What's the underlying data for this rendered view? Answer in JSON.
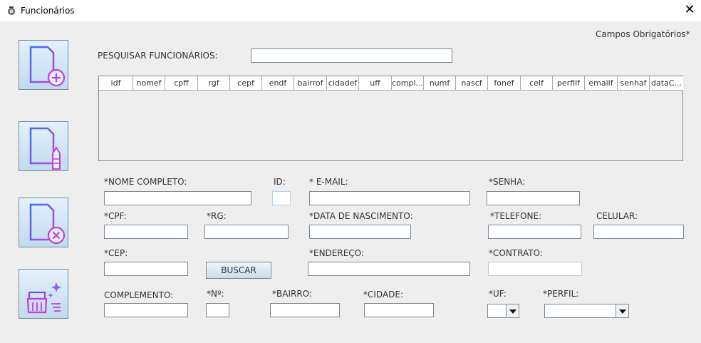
{
  "window": {
    "title": "Funcionários"
  },
  "required_note": "Campos Obrigatórios*",
  "search": {
    "label": "PESQUISAR FUNCIONÁRIOS:",
    "value": ""
  },
  "table": {
    "columns": [
      "idf",
      "nomef",
      "cpff",
      "rgf",
      "cepf",
      "endf",
      "bairrof",
      "cidadef",
      "uff",
      "compl...",
      "numf",
      "nascf",
      "fonef",
      "celf",
      "perfilf",
      "emailf",
      "senhaf",
      "dataC..."
    ],
    "rows": []
  },
  "sidebar": {
    "buttons": [
      {
        "icon": "document-add-icon"
      },
      {
        "icon": "document-edit-icon"
      },
      {
        "icon": "document-delete-icon"
      },
      {
        "icon": "broom-clean-icon"
      }
    ]
  },
  "form": {
    "nome": {
      "label": "*NOME COMPLETO:",
      "value": ""
    },
    "id": {
      "label": "ID:",
      "value": ""
    },
    "email": {
      "label": "* E-MAIL:",
      "value": ""
    },
    "senha": {
      "label": "*SENHA:",
      "value": ""
    },
    "cpf": {
      "label": "*CPF:",
      "value": ""
    },
    "rg": {
      "label": "*RG:",
      "value": ""
    },
    "nascimento": {
      "label": "*DATA DE NASCIMENTO:",
      "value": ""
    },
    "telefone": {
      "label": "*TELEFONE:",
      "value": ""
    },
    "celular": {
      "label": "CELULAR:",
      "value": ""
    },
    "cep": {
      "label": "*CEP:",
      "value": ""
    },
    "buscar_label": "BUSCAR",
    "endereco": {
      "label": "*ENDEREÇO:",
      "value": ""
    },
    "contrato": {
      "label": "*CONTRATO:",
      "value": ""
    },
    "complemento": {
      "label": "COMPLEMENTO:",
      "value": ""
    },
    "numero": {
      "label": "*Nº:",
      "value": ""
    },
    "bairro": {
      "label": "*BAIRRO:",
      "value": ""
    },
    "cidade": {
      "label": "*CIDADE:",
      "value": ""
    },
    "uf": {
      "label": "*UF:",
      "value": ""
    },
    "perfil": {
      "label": "*PERFIL:",
      "value": ""
    }
  }
}
